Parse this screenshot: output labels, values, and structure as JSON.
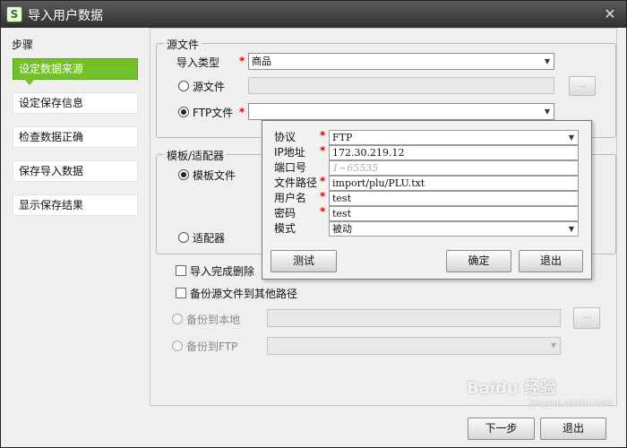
{
  "window": {
    "title": "导入用户数据",
    "app_icon": "S",
    "close_icon": "✕"
  },
  "sidebar": {
    "label": "步骤",
    "items": [
      {
        "label": "设定数据来源",
        "active": true
      },
      {
        "label": "设定保存信息",
        "active": false
      },
      {
        "label": "检查数据正确",
        "active": false
      },
      {
        "label": "保存导入数据",
        "active": false
      },
      {
        "label": "显示保存结果",
        "active": false
      }
    ]
  },
  "source_group": {
    "title": "源文件",
    "import_type_label": "导入类型",
    "import_type_value": "商品",
    "source_file_label": "源文件",
    "ftp_file_label": "FTP文件",
    "required_mark": "*",
    "browse_label": "..."
  },
  "template_group": {
    "title": "模板/适配器",
    "template_label": "模板文件",
    "adapter_label": "适配器"
  },
  "options": {
    "delete_after_import_label": "导入完成删除",
    "backup_label": "备份源文件到其他路径",
    "backup_local_label": "备份到本地",
    "backup_ftp_label": "备份到FTP"
  },
  "ftp_dialog": {
    "protocol_label": "协议",
    "protocol_value": "FTP",
    "ip_label": "IP地址",
    "ip_value": "172.30.219.12",
    "port_label": "端口号",
    "port_placeholder": "1~65535",
    "path_label": "文件路径",
    "path_value": "import/plu/PLU.txt",
    "user_label": "用户名",
    "user_value": "test",
    "password_label": "密码",
    "password_value": "test",
    "mode_label": "模式",
    "mode_value": "被动",
    "required_mark": "*",
    "test_button": "测试",
    "ok_button": "确定",
    "exit_button": "退出"
  },
  "footer": {
    "next_button": "下一步",
    "exit_button": "退出"
  },
  "watermark": {
    "text": "Baidu 经验",
    "sub": "jingyan.baidu.com"
  }
}
